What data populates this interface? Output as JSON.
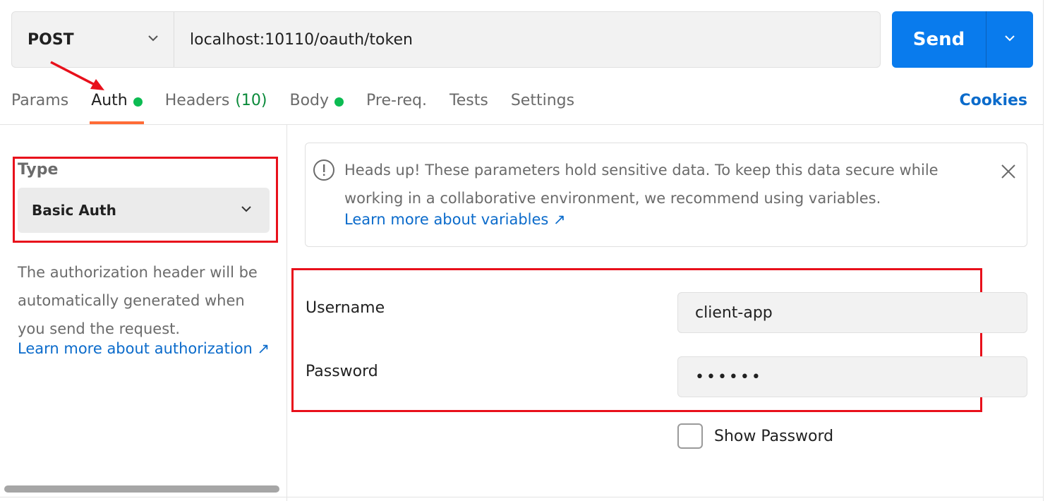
{
  "request": {
    "method": "POST",
    "url": "localhost:10110/oauth/token",
    "send_label": "Send"
  },
  "tabs": [
    {
      "label": "Params"
    },
    {
      "label": "Auth",
      "active": true,
      "indicator": "green-dot"
    },
    {
      "label": "Headers",
      "count": "(10)"
    },
    {
      "label": "Body",
      "indicator": "green-dot"
    },
    {
      "label": "Pre-req."
    },
    {
      "label": "Tests"
    },
    {
      "label": "Settings"
    }
  ],
  "cookies_label": "Cookies",
  "auth": {
    "type_label": "Type",
    "type_value": "Basic Auth",
    "description": "The authorization header will be automatically generated when you send the request.",
    "learn_more": "Learn more about authorization ↗"
  },
  "notice": {
    "text": "Heads up! These parameters hold sensitive data. To keep this data secure while working in a collaborative environment, we recommend using variables.",
    "link": "Learn more about variables ↗"
  },
  "credentials": {
    "username_label": "Username",
    "username_value": "client-app",
    "password_label": "Password",
    "password_value": "••••••",
    "show_password_label": "Show Password"
  },
  "colors": {
    "accent": "#097bed",
    "active_tab_underline": "#ff6c37",
    "status_dot": "#0cbb52",
    "annotation": "#e8101b",
    "link": "#0b6bcb"
  }
}
